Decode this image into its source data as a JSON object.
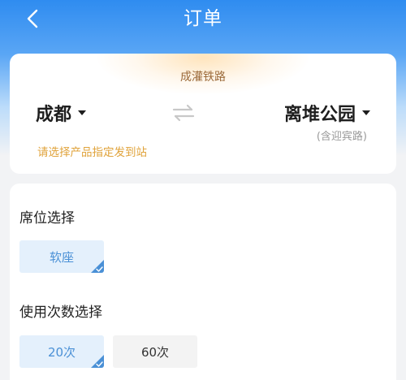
{
  "nav": {
    "title": "订单"
  },
  "route": {
    "line_name": "成灌铁路",
    "from": "成都",
    "to": "离堆公园",
    "to_sub": "(含迎宾路)",
    "hint": "请选择产品指定发到站"
  },
  "seat": {
    "title": "席位选择",
    "options": [
      {
        "label": "软座",
        "selected": true
      }
    ]
  },
  "usage": {
    "title": "使用次数选择",
    "options": [
      {
        "label": "20次",
        "selected": true
      },
      {
        "label": "60次",
        "selected": false
      }
    ]
  },
  "colors": {
    "primary": "#2f8cf0",
    "selected_bg": "#e4f0fc",
    "selected_text": "#4a90d6",
    "hint": "#e0a33b"
  }
}
